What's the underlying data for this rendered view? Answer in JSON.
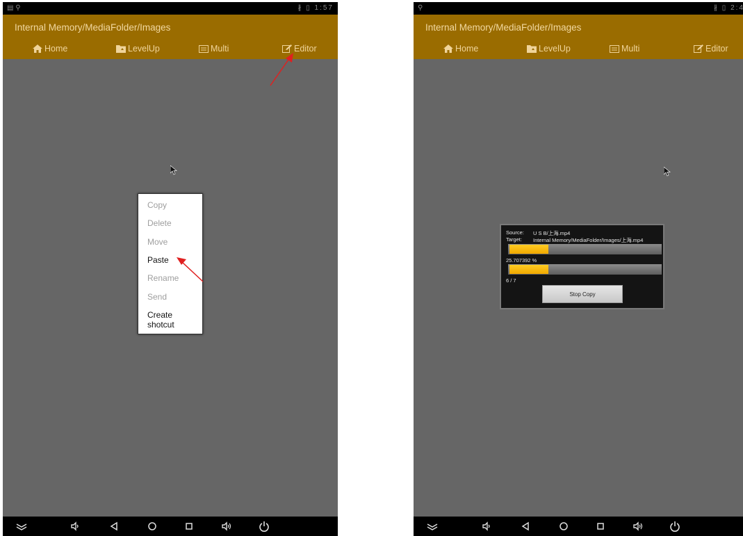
{
  "left_screen": {
    "status": {
      "left": "▤ ⚲",
      "right": "∦ ▯ 1:57"
    },
    "path": "Internal Memory/MediaFolder/Images",
    "toolbar": {
      "home": "Home",
      "levelup": "LevelUp",
      "multi": "Multi",
      "editor": "Editor"
    },
    "menu": {
      "items": [
        "Copy",
        "Delete",
        "Move",
        "Paste",
        "Rename",
        "Send",
        "Create shotcut"
      ],
      "active_item": "Paste"
    }
  },
  "right_screen": {
    "status": {
      "left": "⚲",
      "right": "∦ ▯ 2:4"
    },
    "path": "Internal Memory/MediaFolder/Images",
    "toolbar": {
      "home": "Home",
      "levelup": "LevelUp",
      "multi": "Multi",
      "editor": "Editor"
    },
    "dialog": {
      "source_label": "Source:",
      "source_value": "U S B/上海.mp4",
      "target_label": "Target:",
      "target_value": "Internal Memory/MediaFolder/Images/上海.mp4",
      "file_progress_text": "25.707392 %",
      "file_progress": 25.707392,
      "count_text": "6 / 7",
      "overall_progress": 0.26,
      "stop_button": "Stop Copy"
    }
  },
  "colors": {
    "appbar": "#9a6c00",
    "toolbar_text": "#f0d49a",
    "screen_bg": "#666666",
    "progress": "#f5b800",
    "annotation_arrow": "#e02020"
  },
  "icons": [
    "home-icon",
    "folder-up-icon",
    "multi-select-icon",
    "edit-icon",
    "keyboard-hide-icon",
    "volume-down-icon",
    "back-icon",
    "home-circle-icon",
    "recents-icon",
    "volume-up-icon",
    "power-icon",
    "mouse-cursor-icon"
  ]
}
